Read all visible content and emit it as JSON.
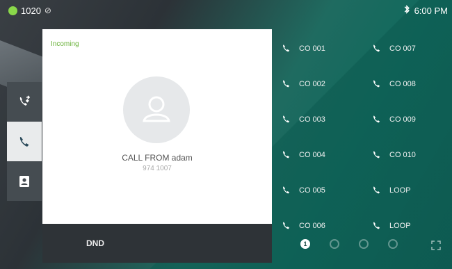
{
  "status_bar": {
    "account": "1020",
    "time": "6:00 PM"
  },
  "call": {
    "status": "Incoming",
    "caller": "CALL FROM adam",
    "number": "974 1007"
  },
  "bottom": {
    "dnd_label": "DND"
  },
  "speed_keys": [
    "CO 001",
    "CO 007",
    "CO 002",
    "CO 008",
    "CO 003",
    "CO 009",
    "CO 004",
    "CO 010",
    "CO 005",
    "LOOP",
    "CO 006",
    "LOOP"
  ],
  "pager": {
    "current": "1"
  },
  "sidebar": {
    "items": [
      "call-history-icon",
      "phone-icon",
      "contacts-icon"
    ],
    "active_index": 1
  },
  "colors": {
    "status_online": "#8ad84a",
    "incoming_text": "#6ab23a",
    "teal_bg": "#11695d"
  }
}
